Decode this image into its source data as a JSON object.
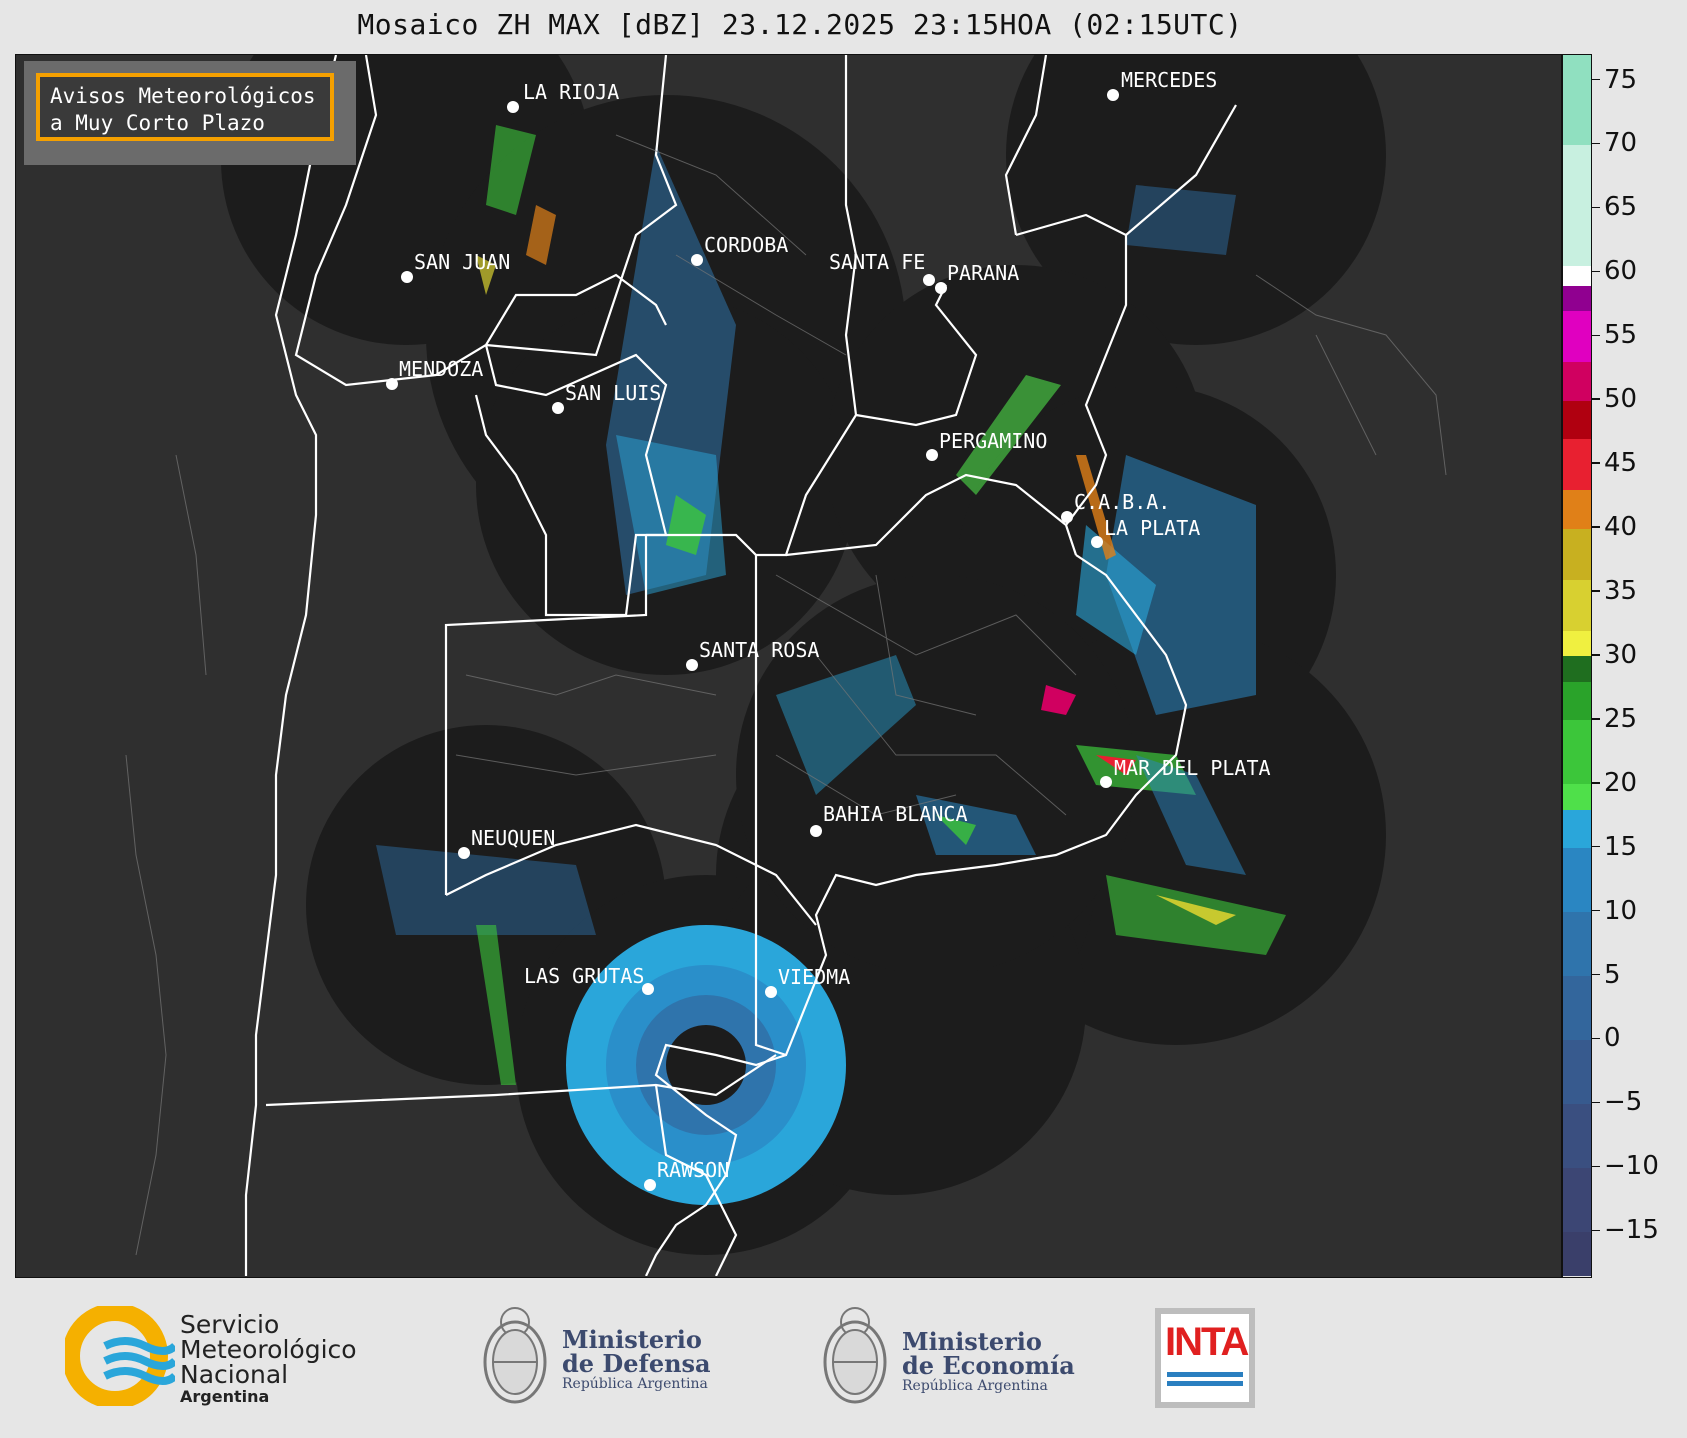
{
  "title": "Mosaico ZH MAX [dBZ] 23.12.2025 23:15HOA (02:15UTC)",
  "legend_box": {
    "line1": "Avisos Meteorológicos",
    "line2": "a Muy Corto Plazo",
    "border_color": "#f5a000"
  },
  "cities": [
    {
      "name": "LA RIOJA"
    },
    {
      "name": "CORDOBA"
    },
    {
      "name": "SAN JUAN"
    },
    {
      "name": "MENDOZA"
    },
    {
      "name": "SAN LUIS"
    },
    {
      "name": "SANTA FE"
    },
    {
      "name": "PARANA"
    },
    {
      "name": "MERCEDES"
    },
    {
      "name": "PERGAMINO"
    },
    {
      "name": "C.A.B.A."
    },
    {
      "name": "LA PLATA"
    },
    {
      "name": "SANTA ROSA"
    },
    {
      "name": "NEUQUEN"
    },
    {
      "name": "BAHIA BLANCA"
    },
    {
      "name": "MAR DEL PLATA"
    },
    {
      "name": "LAS GRUTAS"
    },
    {
      "name": "VIEDMA"
    },
    {
      "name": "RAWSON"
    }
  ],
  "colorbar": {
    "min": -18.5,
    "max": 77,
    "ticks": [
      75,
      70,
      65,
      60,
      55,
      50,
      45,
      40,
      35,
      30,
      25,
      20,
      15,
      10,
      5,
      0,
      -5,
      -10,
      -15
    ],
    "tick_labels": [
      "75",
      "70",
      "65",
      "60",
      "55",
      "50",
      "45",
      "40",
      "35",
      "30",
      "25",
      "20",
      "15",
      "10",
      "5",
      "0",
      "−5",
      "−10",
      "−15"
    ],
    "bands": [
      {
        "from": -18.5,
        "to": -15,
        "color": "#3a3f6a"
      },
      {
        "from": -15,
        "to": -10,
        "color": "#3c4674"
      },
      {
        "from": -10,
        "to": -5,
        "color": "#3a4f80"
      },
      {
        "from": -5,
        "to": 0,
        "color": "#375a8e"
      },
      {
        "from": 0,
        "to": 5,
        "color": "#33669c"
      },
      {
        "from": 5,
        "to": 10,
        "color": "#2f74ac"
      },
      {
        "from": 10,
        "to": 15,
        "color": "#2a86c2"
      },
      {
        "from": 15,
        "to": 18,
        "color": "#2aa6da"
      },
      {
        "from": 18,
        "to": 20,
        "color": "#4fe04a"
      },
      {
        "from": 20,
        "to": 25,
        "color": "#3cc63a"
      },
      {
        "from": 25,
        "to": 28,
        "color": "#2aa32a"
      },
      {
        "from": 28,
        "to": 30,
        "color": "#1f6e1f"
      },
      {
        "from": 30,
        "to": 32,
        "color": "#f0f040"
      },
      {
        "from": 32,
        "to": 36,
        "color": "#d8d030"
      },
      {
        "from": 36,
        "to": 40,
        "color": "#c8b020"
      },
      {
        "from": 40,
        "to": 43,
        "color": "#e08018"
      },
      {
        "from": 43,
        "to": 47,
        "color": "#e82030"
      },
      {
        "from": 47,
        "to": 50,
        "color": "#b00010"
      },
      {
        "from": 50,
        "to": 53,
        "color": "#d00060"
      },
      {
        "from": 53,
        "to": 57,
        "color": "#e000c0"
      },
      {
        "from": 57,
        "to": 59,
        "color": "#900090"
      },
      {
        "from": 59,
        "to": 60.5,
        "color": "#ffffff"
      },
      {
        "from": 60.5,
        "to": 70,
        "color": "#c8f0e0"
      },
      {
        "from": 70,
        "to": 77,
        "color": "#90e0c0"
      }
    ]
  },
  "logos": {
    "smn_line1": "Servicio",
    "smn_line2": "Meteorológico",
    "smn_line3": "Nacional",
    "smn_line4": "Argentina",
    "defensa_title1": "Ministerio",
    "defensa_title2": "de Defensa",
    "defensa_sub": "República Argentina",
    "economia_title1": "Ministerio",
    "economia_title2": "de Economía",
    "economia_sub": "República Argentina",
    "inta": "INTA"
  }
}
